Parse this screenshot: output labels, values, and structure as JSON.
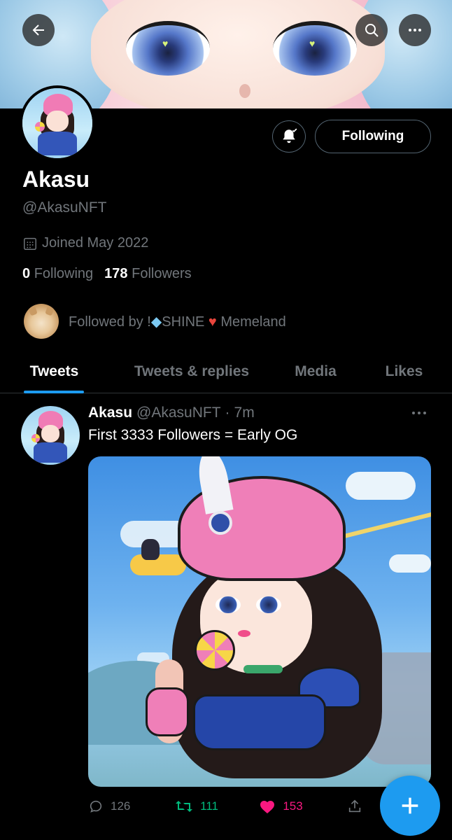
{
  "profile": {
    "name": "Akasu",
    "handle": "@AkasuNFT",
    "joined": "Joined May 2022",
    "following_count": "0",
    "following_label": "Following",
    "followers_count": "178",
    "followers_label": "Followers",
    "follow_button_label": "Following"
  },
  "followed_by": {
    "prefix": "Followed by !",
    "name1": "SHINE",
    "name2": "Memeland"
  },
  "tabs": [
    {
      "label": "Tweets",
      "active": true
    },
    {
      "label": "Tweets & replies",
      "active": false
    },
    {
      "label": "Media",
      "active": false
    },
    {
      "label": "Likes",
      "active": false
    }
  ],
  "tweet": {
    "name": "Akasu",
    "handle": "@AkasuNFT",
    "separator": "·",
    "time": "7m",
    "text": "First 3333 Followers = Early OG",
    "replies": "126",
    "retweets": "111",
    "likes": "153"
  },
  "colors": {
    "accent": "#1d9bf0",
    "retweet": "#00ba7c",
    "like": "#f91880",
    "muted": "#71767b",
    "background": "#000000"
  },
  "icons": [
    "back-arrow-icon",
    "search-icon",
    "more-icon",
    "bell-check-icon",
    "calendar-icon",
    "gem-icon",
    "heart-icon",
    "reply-icon",
    "retweet-icon",
    "like-icon",
    "share-icon",
    "compose-plus-icon"
  ]
}
